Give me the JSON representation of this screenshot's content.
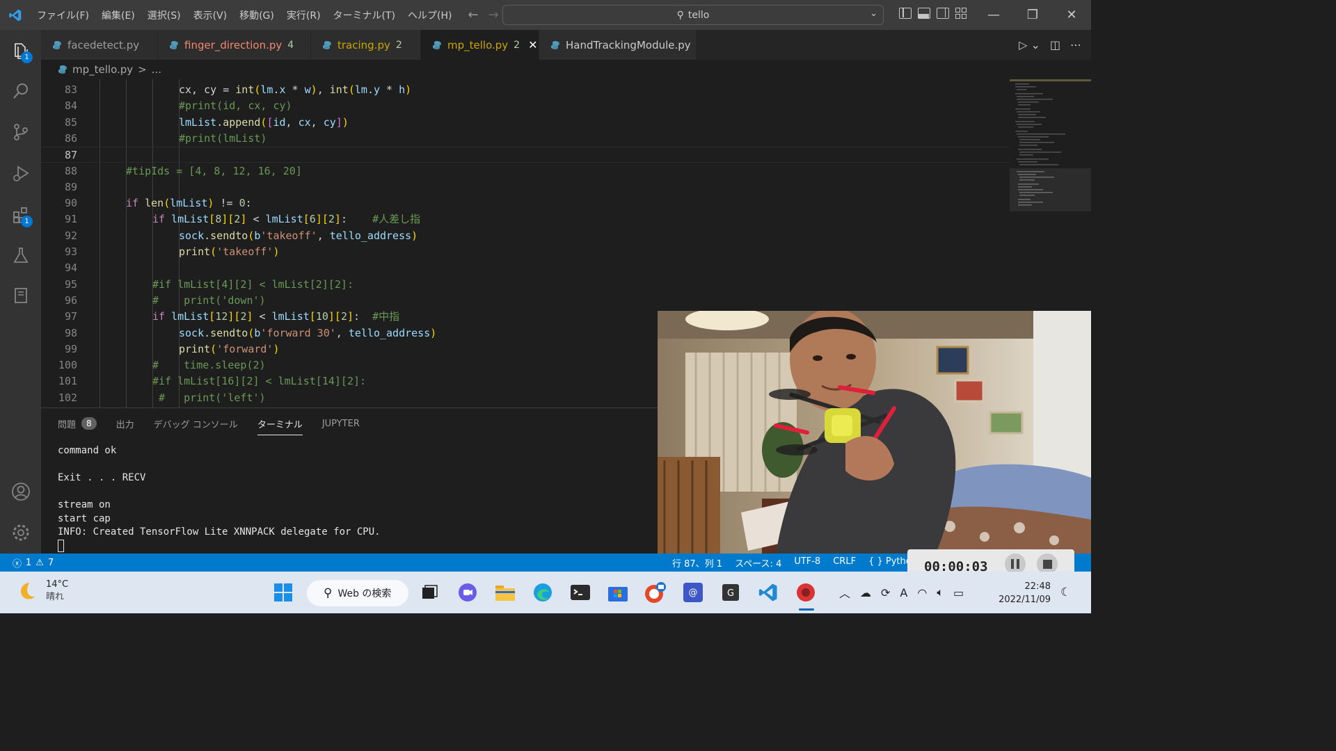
{
  "menu": [
    "ファイル(F)",
    "編集(E)",
    "選択(S)",
    "表示(V)",
    "移動(G)",
    "実行(R)",
    "ターミナル(T)",
    "ヘルプ(H)"
  ],
  "search": {
    "text": "tello"
  },
  "activity": {
    "explorer_badge": "1",
    "extensions_badge": "1"
  },
  "tabs": [
    {
      "label": "facedetect.py",
      "count": "",
      "state": "normal"
    },
    {
      "label": "finger_direction.py",
      "count": "4",
      "state": "modified"
    },
    {
      "label": "tracing.py",
      "count": "2",
      "state": "warn"
    },
    {
      "label": "mp_tello.py",
      "count": "2",
      "state": "active"
    },
    {
      "label": "HandTrackingModule.py",
      "count": "",
      "state": "normal"
    }
  ],
  "breadcrumb": {
    "file": "mp_tello.py",
    "sep": ">",
    "rest": "..."
  },
  "code": [
    {
      "n": "83",
      "indent": 3,
      "html": "cx, cy = <span class=\"fn\">int</span><span class=\"br1\">(</span><span class=\"var\">lm</span>.<span class=\"var\">x</span> * <span class=\"var\">w</span><span class=\"br1\">)</span>, <span class=\"fn\">int</span><span class=\"br1\">(</span><span class=\"var\">lm</span>.<span class=\"var\">y</span> * <span class=\"var\">h</span><span class=\"br1\">)</span>"
    },
    {
      "n": "84",
      "indent": 3,
      "html": "<span class=\"cm\">#print(id, cx, cy)</span>"
    },
    {
      "n": "85",
      "indent": 3,
      "html": "<span class=\"var\">lmList</span>.<span class=\"fn\">append</span><span class=\"br1\">(</span><span class=\"br2\">[</span><span class=\"var\">id</span>, <span class=\"var\">cx</span>, <span class=\"var\">cy</span><span class=\"br2\">]</span><span class=\"br1\">)</span>"
    },
    {
      "n": "86",
      "indent": 3,
      "html": "<span class=\"cm\">#print(lmList)</span>"
    },
    {
      "n": "87",
      "indent": 0,
      "html": "",
      "current": true
    },
    {
      "n": "88",
      "indent": 1,
      "html": "<span class=\"cm\">#tipIds = [4, 8, 12, 16, 20]</span>"
    },
    {
      "n": "89",
      "indent": 0,
      "html": ""
    },
    {
      "n": "90",
      "indent": 1,
      "html": "<span class=\"kw\">if</span> <span class=\"fn\">len</span><span class=\"br1\">(</span><span class=\"var\">lmList</span><span class=\"br1\">)</span> != <span class=\"num\">0</span>:"
    },
    {
      "n": "91",
      "indent": 2,
      "html": "<span class=\"kw\">if</span> <span class=\"var\">lmList</span><span class=\"br1\">[</span><span class=\"num\">8</span><span class=\"br1\">][</span><span class=\"num\">2</span><span class=\"br1\">]</span> &lt; <span class=\"var\">lmList</span><span class=\"br1\">[</span><span class=\"num\">6</span><span class=\"br1\">][</span><span class=\"num\">2</span><span class=\"br1\">]</span>:    <span class=\"cm\">#人差し指</span>"
    },
    {
      "n": "92",
      "indent": 3,
      "html": "<span class=\"var\">sock</span>.<span class=\"fn\">sendto</span><span class=\"br1\">(</span><span class=\"var\">b</span><span class=\"str\">'takeoff'</span>, <span class=\"var\">tello_address</span><span class=\"br1\">)</span>"
    },
    {
      "n": "93",
      "indent": 3,
      "html": "<span class=\"fn\">print</span><span class=\"br1\">(</span><span class=\"str\">'takeoff'</span><span class=\"br1\">)</span>"
    },
    {
      "n": "94",
      "indent": 0,
      "html": ""
    },
    {
      "n": "95",
      "indent": 2,
      "html": "<span class=\"cm\">#if lmList[4][2] &lt; lmList[2][2]:</span>"
    },
    {
      "n": "96",
      "indent": 2,
      "html": "<span class=\"cm\">#    print('down')</span>"
    },
    {
      "n": "97",
      "indent": 2,
      "html": "<span class=\"kw\">if</span> <span class=\"var\">lmList</span><span class=\"br1\">[</span><span class=\"num\">12</span><span class=\"br1\">][</span><span class=\"num\">2</span><span class=\"br1\">]</span> &lt; <span class=\"var\">lmList</span><span class=\"br1\">[</span><span class=\"num\">10</span><span class=\"br1\">][</span><span class=\"num\">2</span><span class=\"br1\">]</span>:  <span class=\"cm\">#中指</span>"
    },
    {
      "n": "98",
      "indent": 3,
      "html": "<span class=\"var\">sock</span>.<span class=\"fn\">sendto</span><span class=\"br1\">(</span><span class=\"var\">b</span><span class=\"str\">'forward 30'</span>, <span class=\"var\">tello_address</span><span class=\"br1\">)</span>"
    },
    {
      "n": "99",
      "indent": 3,
      "html": "<span class=\"fn\">print</span><span class=\"br1\">(</span><span class=\"str\">'forward'</span><span class=\"br1\">)</span>"
    },
    {
      "n": "100",
      "indent": 2,
      "html": "<span class=\"cm\">#    time.sleep(2)</span>"
    },
    {
      "n": "101",
      "indent": 2,
      "html": "<span class=\"cm\">#if lmList[16][2] &lt; lmList[14][2]:</span>"
    },
    {
      "n": "102",
      "indent": 2,
      "html": "<span class=\"cm\"> #   print('left')</span>"
    }
  ],
  "panel": {
    "tabs": [
      "問題",
      "出力",
      "デバッグ コンソール",
      "ターミナル",
      "JUPYTER"
    ],
    "problems_count": "8",
    "terminal_lines": [
      "command ok",
      "",
      "Exit . . . RECV",
      "",
      "stream on",
      "start cap",
      "INFO: Created TensorFlow Lite XNNPACK delegate for CPU."
    ]
  },
  "statusbar": {
    "errors": "1",
    "warnings": "7",
    "position": "行 87、列 1",
    "spaces": "スペース: 4",
    "encoding": "UTF-8",
    "eol": "CRLF",
    "language": "Pytho"
  },
  "recording": {
    "timer": "00:00:03"
  },
  "taskbar": {
    "temp": "14°C",
    "weather": "晴れ",
    "search_label": "Web の検索",
    "time": "22:48",
    "date": "2022/11/09"
  },
  "colors": {
    "statusbar": "#007acc",
    "accent": "#0078d4",
    "titlebar": "#3c3c3c",
    "editor": "#1e1e1e"
  }
}
